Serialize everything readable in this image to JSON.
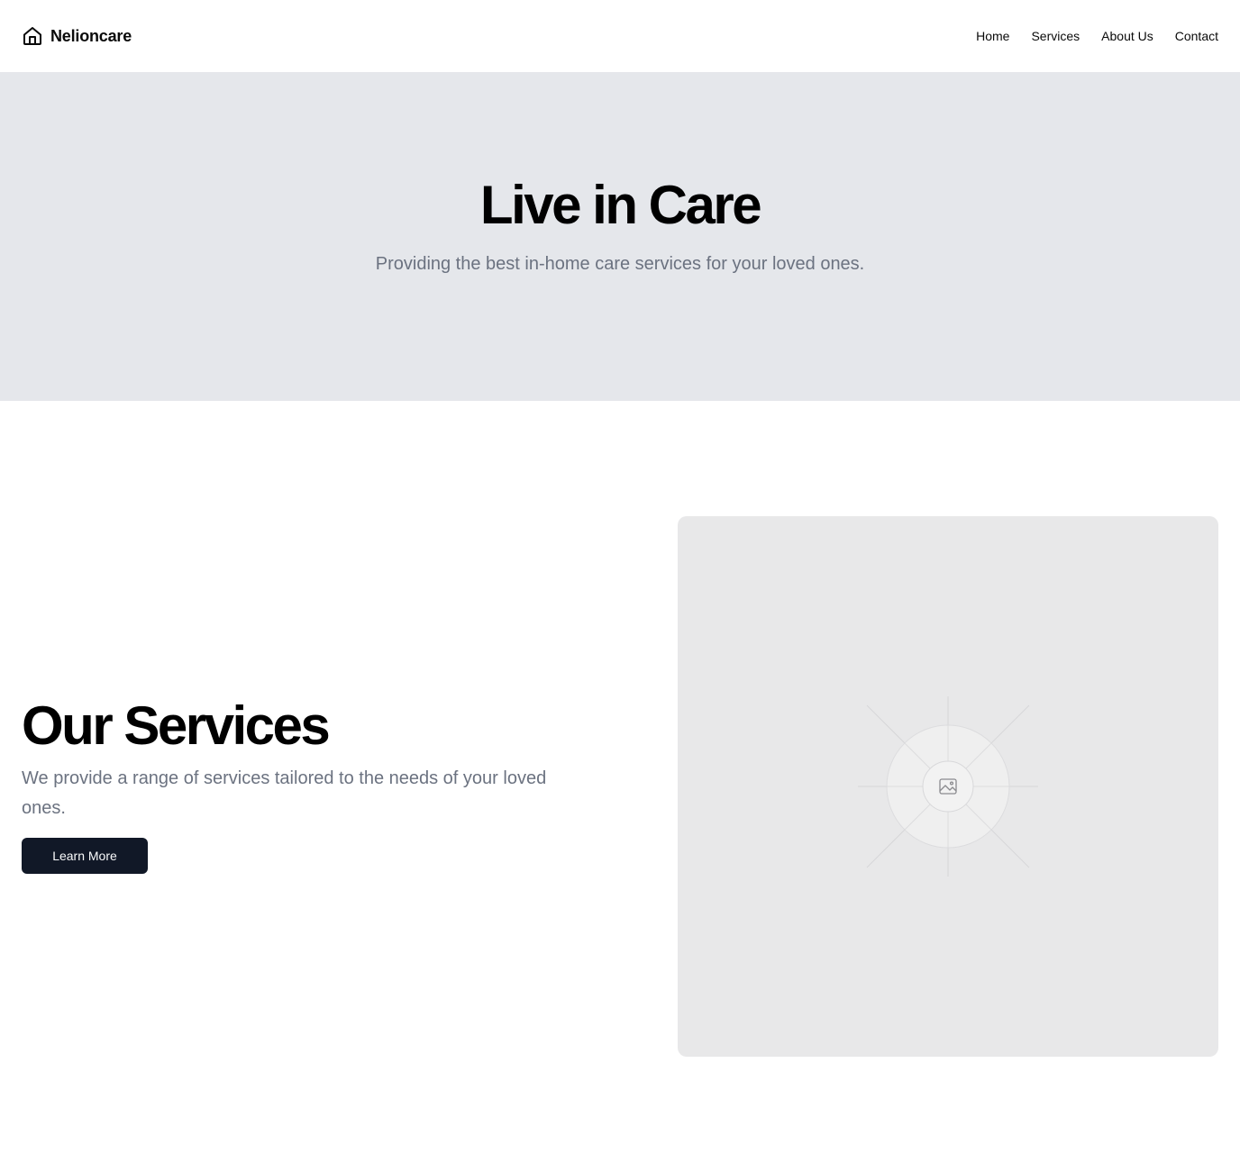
{
  "header": {
    "brand_name": "Nelioncare",
    "brand_icon": "home-icon",
    "nav": [
      {
        "label": "Home"
      },
      {
        "label": "Services"
      },
      {
        "label": "About Us"
      },
      {
        "label": "Contact"
      }
    ]
  },
  "hero": {
    "title": "Live in Care",
    "subtitle": "Providing the best in-home care services for your loved ones."
  },
  "services": {
    "title": "Our Services",
    "description": "We provide a range of services tailored to the needs of your loved ones.",
    "button_label": "Learn More",
    "image_icon": "image-placeholder-icon"
  },
  "colors": {
    "hero_bg": "#e5e7eb",
    "button_bg": "#111827",
    "muted_text": "#6b7280"
  }
}
